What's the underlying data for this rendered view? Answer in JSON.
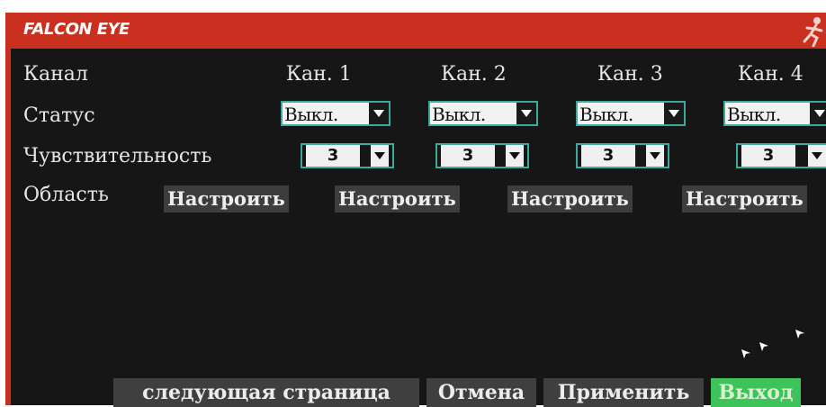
{
  "brand": "FALCON EYE",
  "rows": {
    "channel_label": "Канал",
    "status_label": "Статус",
    "sensitivity_label": "Чувствительность",
    "area_label": "Область"
  },
  "channels": [
    {
      "name": "Кан. 1",
      "status": "Выкл.",
      "sensitivity": "3",
      "area_button": "Настроить"
    },
    {
      "name": "Кан. 2",
      "status": "Выкл.",
      "sensitivity": "3",
      "area_button": "Настроить"
    },
    {
      "name": "Кан. 3",
      "status": "Выкл.",
      "sensitivity": "3",
      "area_button": "Настроить"
    },
    {
      "name": "Кан. 4",
      "status": "Выкл.",
      "sensitivity": "3",
      "area_button": "Настроить"
    }
  ],
  "buttons": {
    "next_page": "следующая  страница",
    "cancel": "Отмена",
    "apply": "Применить",
    "exit": "Выход"
  },
  "colors": {
    "title_bar": "#c9301f",
    "background": "#161616",
    "focus_border": "#3fa9a0",
    "active_button": "#3ec35a"
  },
  "icons": {
    "corner": "running-figure-icon",
    "dropdown": "chevron-down-icon",
    "pointer": "mouse-pointer-icon"
  }
}
